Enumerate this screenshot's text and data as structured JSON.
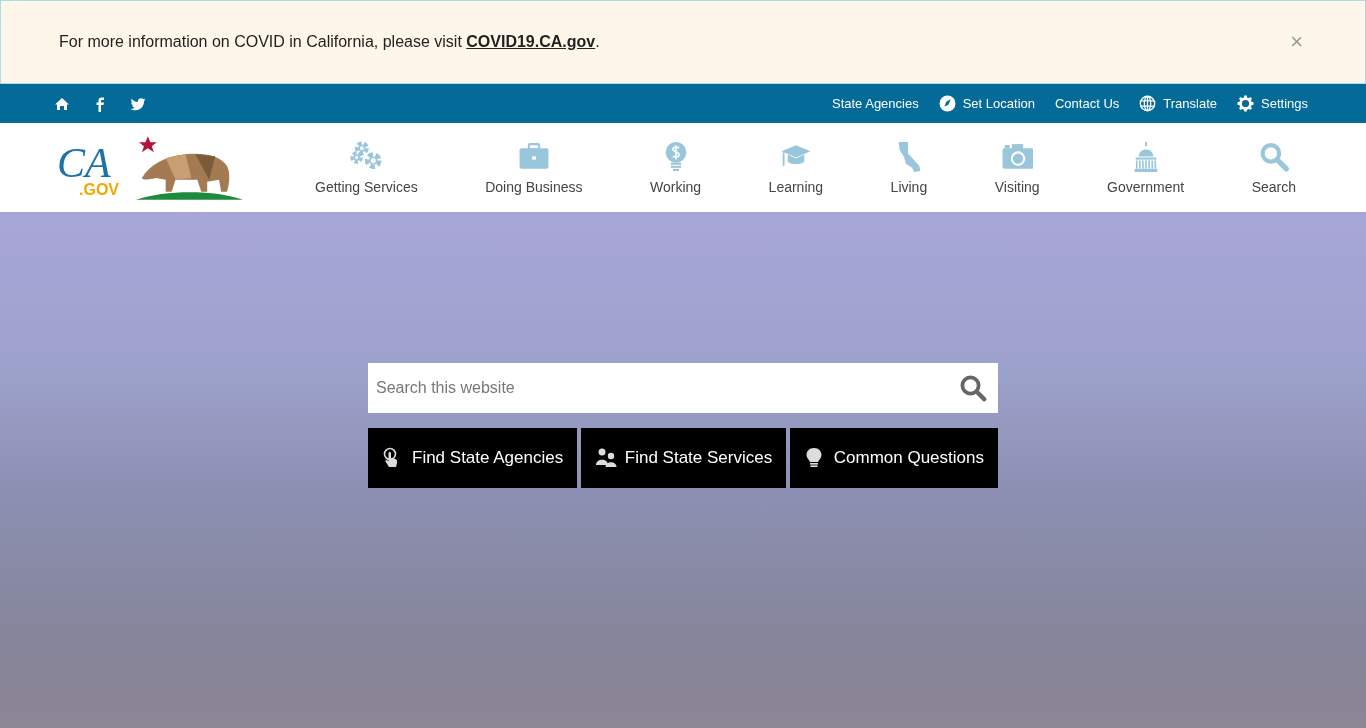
{
  "alert": {
    "text_before": "For more information on COVID in California, please visit ",
    "link": "COVID19.CA.gov",
    "text_after": ".",
    "close": "×"
  },
  "utility_bar": {
    "social": [
      {
        "kind": "home"
      },
      {
        "kind": "facebook"
      },
      {
        "kind": "twitter"
      }
    ],
    "links": [
      {
        "label": "State Agencies",
        "kind": "none"
      },
      {
        "label": "Set Location",
        "kind": "location"
      },
      {
        "label": "Contact Us",
        "kind": "none"
      },
      {
        "label": "Translate",
        "kind": "globe"
      },
      {
        "label": "Settings",
        "kind": "gear"
      }
    ]
  },
  "logo": {
    "ca": "CA",
    "gov": ".GOV"
  },
  "main_nav": [
    {
      "label": "Getting Services",
      "kind": "gears"
    },
    {
      "label": "Doing Business",
      "kind": "briefcase"
    },
    {
      "label": "Working",
      "kind": "bulb"
    },
    {
      "label": "Learning",
      "kind": "cap"
    },
    {
      "label": "Living",
      "kind": "state"
    },
    {
      "label": "Visiting",
      "kind": "camera"
    },
    {
      "label": "Government",
      "kind": "capitol"
    },
    {
      "label": "Search",
      "kind": "search"
    }
  ],
  "hero": {
    "search": {
      "placeholder": "Search this website"
    },
    "buttons": [
      {
        "label": "Find State Agencies",
        "kind": "pointer"
      },
      {
        "label": "Find State Services",
        "kind": "people"
      },
      {
        "label": "Common Questions",
        "kind": "bulb"
      }
    ]
  }
}
